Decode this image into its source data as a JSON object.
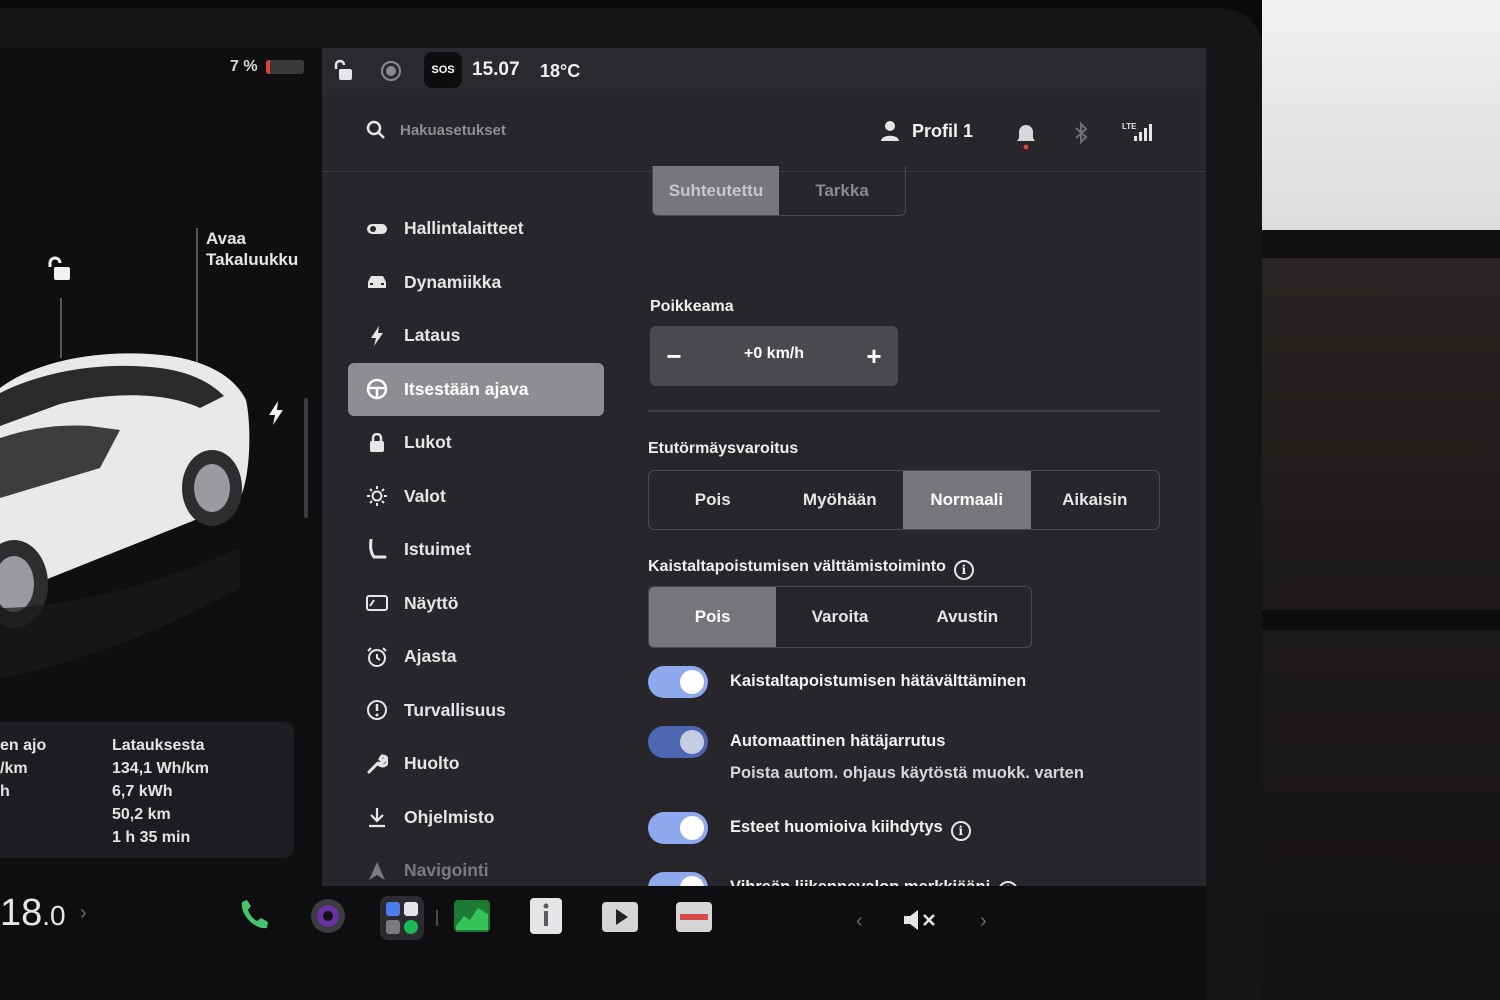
{
  "car_panel": {
    "battery_percent": "7 %",
    "battery_level": 0.07,
    "trunk_label_line1": "Avaa",
    "trunk_label_line2": "Takaluukku",
    "stats": {
      "left_col": [
        "en ajo",
        "/km",
        "h"
      ],
      "right_header": "Latauksesta",
      "right_values": [
        "134,1 Wh/km",
        "6,7 kWh",
        "50,2 km",
        "1 h 35 min"
      ]
    }
  },
  "statusbar": {
    "sos_label": "SOS",
    "time": "15.07",
    "temperature": "18°C"
  },
  "topbar": {
    "search_placeholder": "Hakuasetukset",
    "profile_name": "Profil 1",
    "network_label": "LTE"
  },
  "sidebar": {
    "items": [
      {
        "label": "Hallintalaitteet",
        "icon": "toggle-icon"
      },
      {
        "label": "Dynamiikka",
        "icon": "car-icon"
      },
      {
        "label": "Lataus",
        "icon": "bolt-icon"
      },
      {
        "label": "Itsestään ajava",
        "icon": "steering-wheel-icon",
        "active": true
      },
      {
        "label": "Lukot",
        "icon": "lock-icon"
      },
      {
        "label": "Valot",
        "icon": "sun-icon"
      },
      {
        "label": "Istuimet",
        "icon": "seat-icon"
      },
      {
        "label": "Näyttö",
        "icon": "display-icon"
      },
      {
        "label": "Ajasta",
        "icon": "alarm-clock-icon"
      },
      {
        "label": "Turvallisuus",
        "icon": "exclamation-circle-icon"
      },
      {
        "label": "Huolto",
        "icon": "wrench-icon"
      },
      {
        "label": "Ohjelmisto",
        "icon": "download-icon"
      },
      {
        "label": "Navigointi",
        "icon": "navigation-icon"
      }
    ]
  },
  "content": {
    "speed_mode": {
      "options": [
        "Suhteutettu",
        "Tarkka"
      ],
      "selected": "Suhteutettu"
    },
    "offset": {
      "label": "Poikkeama",
      "value": "+0 km/h",
      "minus": "−",
      "plus": "+"
    },
    "forward_collision": {
      "label": "Etutörmäysvaroitus",
      "options": [
        "Pois",
        "Myöhään",
        "Normaali",
        "Aikaisin"
      ],
      "selected": "Normaali"
    },
    "lane_departure": {
      "label": "Kaistaltapoistumisen välttämistoiminto",
      "options": [
        "Pois",
        "Varoita",
        "Avustin"
      ],
      "selected": "Pois"
    },
    "toggles": [
      {
        "label": "Kaistaltapoistumisen hätävälttäminen",
        "on": true
      },
      {
        "label": "Automaattinen hätäjarrutus",
        "sub": "Poista autom. ohjaus käytöstä muokk. varten",
        "on": true
      },
      {
        "label": "Esteet huomioiva kiihdytys",
        "on": true
      },
      {
        "label": "Vihreän liikennevalon merkkiääni",
        "on": true
      }
    ]
  },
  "taskbar": {
    "speed_main": "18",
    "speed_decimal": ".0",
    "icons": [
      "phone-icon",
      "camera-icon",
      "apps-icon",
      "energy-chart-icon",
      "manual-icon",
      "theater-icon",
      "toybox-icon"
    ],
    "volume": "muted"
  },
  "colors": {
    "accent_toggle": "#8fa9ee",
    "selected_segment": "#77767c",
    "battery_low": "#e0433a",
    "phone_green": "#45c46b"
  }
}
